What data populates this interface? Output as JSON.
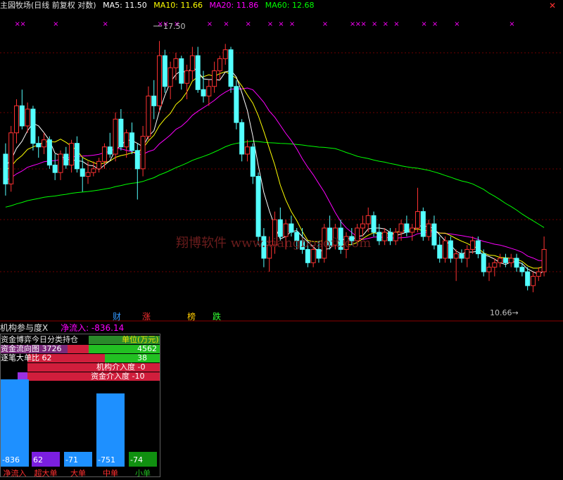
{
  "header": {
    "title": "主図牧场(日线 前复权 对数)",
    "ma5": "MA5: 11.50",
    "ma10": "MA10: 11.66",
    "ma20": "MA20: 11.86",
    "ma60": "MA60: 12.68",
    "close_icon": "close-icon"
  },
  "annotations": {
    "high_label": "17.50",
    "low_label": "10.66→",
    "watermark": "翔博软件 www.xiangbosoft.com"
  },
  "flags": [
    "财",
    "涨",
    "榜",
    "跌"
  ],
  "subchart": {
    "title": "机构参与度X",
    "net_inflow": "净流入: -836.14"
  },
  "panel": {
    "title": "资金博弈今日分类持仓",
    "unit": "单位(万元)",
    "row1_left": "资金流向图 3726",
    "row1_right": "4562",
    "row2_left": "逐笔大单比 62",
    "row2_right": "38",
    "row3": "机构介入度 -0",
    "row4": "资金介入度 -10",
    "bars": [
      {
        "label": "净流入",
        "value": "-836",
        "color": "#1e90ff",
        "level": 1.0
      },
      {
        "label": "超大单",
        "value": "62",
        "color": "#7b1fe0",
        "level": 0.17
      },
      {
        "label": "大单",
        "value": "-71",
        "color": "#1e90ff",
        "level": 0.17
      },
      {
        "label": "中单",
        "value": "-751",
        "color": "#1e90ff",
        "level": 0.84
      },
      {
        "label": "小单",
        "value": "-74",
        "color": "#109010",
        "level": 0.17
      }
    ]
  },
  "chart_data": {
    "type": "candlestick",
    "scale": "log",
    "ylim": [
      10.3,
      18.2
    ],
    "ma_colors": {
      "ma5": "#ffffff",
      "ma10": "#ffff00",
      "ma20": "#ff00ff",
      "ma60": "#00ff00"
    },
    "up_color": "#ff3232",
    "down_color": "#54ffff",
    "max": 17.5,
    "min": 10.66,
    "candles": [
      [
        14.0,
        14.3,
        12.9,
        13.2
      ],
      [
        13.2,
        14.8,
        13.0,
        14.6
      ],
      [
        14.6,
        15.6,
        14.3,
        15.4
      ],
      [
        15.4,
        15.9,
        14.7,
        14.8
      ],
      [
        14.8,
        15.5,
        14.6,
        15.3
      ],
      [
        15.3,
        15.4,
        14.1,
        14.3
      ],
      [
        14.3,
        14.5,
        13.9,
        14.2
      ],
      [
        14.2,
        14.6,
        14.0,
        14.4
      ],
      [
        14.4,
        14.5,
        13.6,
        13.7
      ],
      [
        13.7,
        14.0,
        13.3,
        13.5
      ],
      [
        13.5,
        14.1,
        13.3,
        14.0
      ],
      [
        14.0,
        14.2,
        13.6,
        13.7
      ],
      [
        13.7,
        14.4,
        13.5,
        14.3
      ],
      [
        14.3,
        14.5,
        13.5,
        13.6
      ],
      [
        13.6,
        13.9,
        13.0,
        13.4
      ],
      [
        13.4,
        13.8,
        13.2,
        13.5
      ],
      [
        13.5,
        13.8,
        13.4,
        13.6
      ],
      [
        13.6,
        13.9,
        13.5,
        13.8
      ],
      [
        13.8,
        14.3,
        13.6,
        14.2
      ],
      [
        14.2,
        14.6,
        13.9,
        14.0
      ],
      [
        14.0,
        15.2,
        13.8,
        15.0
      ],
      [
        15.0,
        15.3,
        14.1,
        14.2
      ],
      [
        14.2,
        14.7,
        13.9,
        14.6
      ],
      [
        14.6,
        14.9,
        14.0,
        14.1
      ],
      [
        14.1,
        14.3,
        12.8,
        13.6
      ],
      [
        13.6,
        14.8,
        13.4,
        14.5
      ],
      [
        14.5,
        16.0,
        14.4,
        15.7
      ],
      [
        15.7,
        16.2,
        15.0,
        15.4
      ],
      [
        15.4,
        17.5,
        15.2,
        17.0
      ],
      [
        17.0,
        17.2,
        15.8,
        16.0
      ],
      [
        16.0,
        16.8,
        15.6,
        16.6
      ],
      [
        16.6,
        17.1,
        16.2,
        16.9
      ],
      [
        16.9,
        17.0,
        15.9,
        16.1
      ],
      [
        16.1,
        16.7,
        15.6,
        16.5
      ],
      [
        16.5,
        17.3,
        16.2,
        17.0
      ],
      [
        17.0,
        17.3,
        15.8,
        15.9
      ],
      [
        15.9,
        16.5,
        15.5,
        15.7
      ],
      [
        15.7,
        16.2,
        15.4,
        16.0
      ],
      [
        16.0,
        16.8,
        15.8,
        16.5
      ],
      [
        16.5,
        17.0,
        16.2,
        16.9
      ],
      [
        16.9,
        17.4,
        16.7,
        17.2
      ],
      [
        17.2,
        17.3,
        15.8,
        16.0
      ],
      [
        16.0,
        16.2,
        14.7,
        14.9
      ],
      [
        14.9,
        15.0,
        13.8,
        14.0
      ],
      [
        14.0,
        14.4,
        13.8,
        14.2
      ],
      [
        14.2,
        14.3,
        13.2,
        13.4
      ],
      [
        13.4,
        13.5,
        11.7,
        11.9
      ],
      [
        11.9,
        12.1,
        11.2,
        11.4
      ],
      [
        11.4,
        11.9,
        11.1,
        11.7
      ],
      [
        11.7,
        12.5,
        11.5,
        12.3
      ],
      [
        12.3,
        12.6,
        11.8,
        11.9
      ],
      [
        11.9,
        12.3,
        11.6,
        12.2
      ],
      [
        12.2,
        12.4,
        11.9,
        12.0
      ],
      [
        12.0,
        12.1,
        11.6,
        11.8
      ],
      [
        11.8,
        12.1,
        11.5,
        11.6
      ],
      [
        11.6,
        11.8,
        11.2,
        11.3
      ],
      [
        11.3,
        11.7,
        11.2,
        11.6
      ],
      [
        11.6,
        11.8,
        11.3,
        11.4
      ],
      [
        11.4,
        12.2,
        11.3,
        12.1
      ],
      [
        12.1,
        12.4,
        11.6,
        11.7
      ],
      [
        11.7,
        12.2,
        11.6,
        12.1
      ],
      [
        12.1,
        12.3,
        11.5,
        11.6
      ],
      [
        11.6,
        12.0,
        11.4,
        11.9
      ],
      [
        11.9,
        12.1,
        11.7,
        11.8
      ],
      [
        11.8,
        12.2,
        11.7,
        12.1
      ],
      [
        12.1,
        12.4,
        11.9,
        12.2
      ],
      [
        12.2,
        12.6,
        12.0,
        12.4
      ],
      [
        12.4,
        12.5,
        11.9,
        12.0
      ],
      [
        12.0,
        12.2,
        11.7,
        11.8
      ],
      [
        11.8,
        12.1,
        11.7,
        12.0
      ],
      [
        12.0,
        12.1,
        11.7,
        11.8
      ],
      [
        11.8,
        12.1,
        11.7,
        12.0
      ],
      [
        12.0,
        12.3,
        11.8,
        12.2
      ],
      [
        12.2,
        12.4,
        11.9,
        12.0
      ],
      [
        12.0,
        12.2,
        11.8,
        12.1
      ],
      [
        12.1,
        13.1,
        12.0,
        12.5
      ],
      [
        12.5,
        12.6,
        11.8,
        11.9
      ],
      [
        11.9,
        12.3,
        11.8,
        12.2
      ],
      [
        12.2,
        12.4,
        11.6,
        11.7
      ],
      [
        11.7,
        11.9,
        11.3,
        11.4
      ],
      [
        11.4,
        11.9,
        11.3,
        11.8
      ],
      [
        11.8,
        11.9,
        11.3,
        11.4
      ],
      [
        11.4,
        11.6,
        10.9,
        11.5
      ],
      [
        11.5,
        11.6,
        11.3,
        11.4
      ],
      [
        11.4,
        11.7,
        11.2,
        11.6
      ],
      [
        11.6,
        11.9,
        11.5,
        11.8
      ],
      [
        11.8,
        11.9,
        11.4,
        11.5
      ],
      [
        11.5,
        11.6,
        11.0,
        11.1
      ],
      [
        11.1,
        11.3,
        10.9,
        11.2
      ],
      [
        11.2,
        11.4,
        11.0,
        11.3
      ],
      [
        11.3,
        11.5,
        11.2,
        11.4
      ],
      [
        11.4,
        11.5,
        11.2,
        11.3
      ],
      [
        11.3,
        11.5,
        11.2,
        11.4
      ],
      [
        11.4,
        11.5,
        11.1,
        11.2
      ],
      [
        11.2,
        11.3,
        11.0,
        11.1
      ],
      [
        11.1,
        11.2,
        10.7,
        10.8
      ],
      [
        10.8,
        11.1,
        10.66,
        11.0
      ],
      [
        11.0,
        11.2,
        10.9,
        11.1
      ],
      [
        11.1,
        11.9,
        11.0,
        11.6
      ]
    ]
  }
}
